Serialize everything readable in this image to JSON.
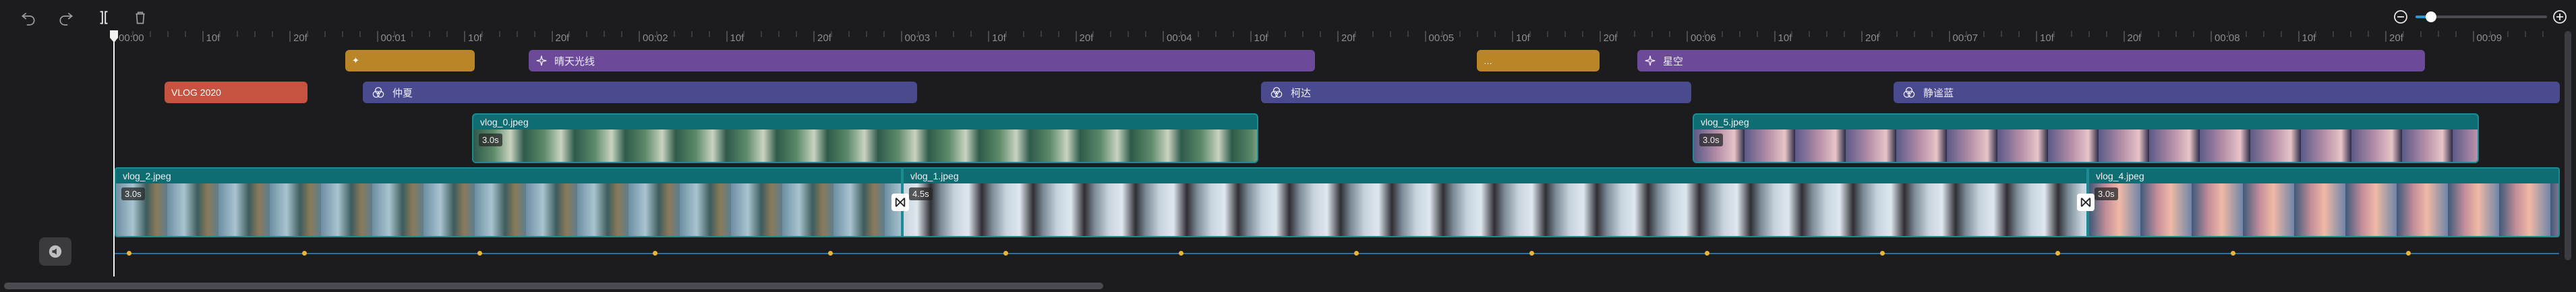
{
  "toolbar": {
    "undo_icon": "undo-icon",
    "redo_icon": "redo-icon",
    "split_icon": "split-icon",
    "delete_icon": "trash-icon"
  },
  "zoom": {
    "level": 0.12,
    "out_icon": "zoom-out-icon",
    "in_icon": "zoom-in-icon"
  },
  "ruler": {
    "labels": [
      "00:00",
      "10f",
      "20f",
      "00:01",
      "10f",
      "20f",
      "00:02",
      "10f",
      "20f",
      "00:03",
      "10f",
      "20f",
      "00:04",
      "10f",
      "20f",
      "00:05",
      "10f",
      "20f",
      "00:06",
      "10f",
      "20f",
      "00:07",
      "10f",
      "20f",
      "00:08",
      "10f",
      "20f",
      "00:09"
    ]
  },
  "tracks": {
    "effects_top": [
      {
        "label": "✦",
        "icon": "text-icon",
        "style": "gold"
      },
      {
        "label": "晴天光线",
        "icon": "sparkle-icon",
        "style": "effect"
      },
      {
        "label": "…",
        "icon": "text-icon",
        "style": "gold"
      },
      {
        "label": "星空",
        "icon": "sparkle-icon",
        "style": "effect"
      }
    ],
    "filters": [
      {
        "label": "VLOG 2020",
        "style": "red"
      },
      {
        "label": "仲夏",
        "icon": "filter-icon"
      },
      {
        "label": "柯达",
        "icon": "filter-icon"
      },
      {
        "label": "静谧蓝",
        "icon": "filter-icon"
      }
    ],
    "overlays": [
      {
        "name": "vlog_0.jpeg",
        "duration": "3.0s"
      },
      {
        "name": "vlog_5.jpeg",
        "duration": "3.0s"
      }
    ],
    "main": [
      {
        "name": "vlog_2.jpeg",
        "duration": "3.0s"
      },
      {
        "name": "vlog_1.jpeg",
        "duration": "4.5s"
      },
      {
        "name": "vlog_4.jpeg",
        "duration": "3.0s"
      }
    ]
  },
  "gutter": {
    "mute_icon": "mute-audio-icon"
  }
}
